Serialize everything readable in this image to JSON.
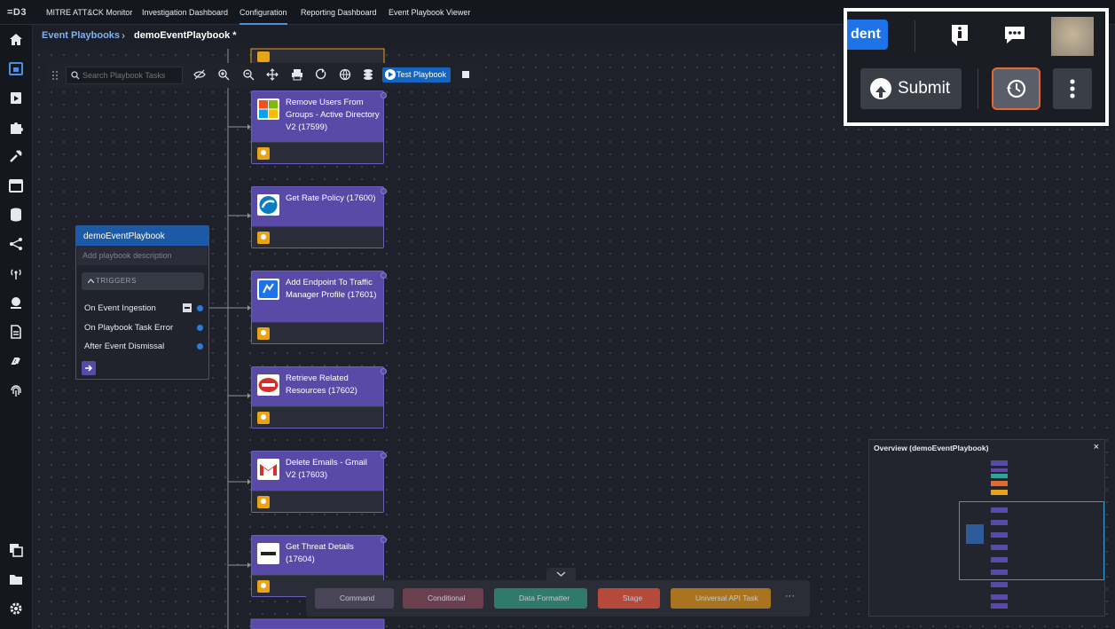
{
  "app": {
    "logo_text": "=D3"
  },
  "topnav": {
    "tabs": [
      {
        "label": "MITRE ATT&CK Monitor"
      },
      {
        "label": "Investigation Dashboard"
      },
      {
        "label": "Configuration"
      },
      {
        "label": "Reporting Dashboard"
      },
      {
        "label": "Event Playbook Viewer"
      }
    ],
    "active_tab": "Configuration"
  },
  "sidebar": {
    "items": [
      "home-icon",
      "calendar-icon",
      "play-icon",
      "puzzle-icon",
      "tools-icon",
      "schedule-icon",
      "database-icon",
      "share-icon",
      "antenna-icon",
      "globe-icon",
      "document-icon",
      "link-icon",
      "fingerprint-icon",
      "copy-icon",
      "folder-icon",
      "settings-icon"
    ]
  },
  "breadcrumb": {
    "parent": "Event Playbooks",
    "separator": "›",
    "current": "demoEventPlaybook *"
  },
  "toolbar": {
    "search_placeholder": "Search Playbook Tasks",
    "test_button": "Test Playbook"
  },
  "start_node": {
    "title": "demoEventPlaybook",
    "description_placeholder": "Add playbook description",
    "triggers_label": "TRIGGERS",
    "triggers": [
      {
        "label": "On Event Ingestion"
      },
      {
        "label": "On Playbook Task Error"
      },
      {
        "label": "After Event Dismissal"
      }
    ]
  },
  "tasks": [
    {
      "name": "Remove Users From Groups - Active Directory V2 (17599)",
      "icon": "microsoft-icon"
    },
    {
      "name": "Get Rate Policy (17600)",
      "icon": "cloud-icon"
    },
    {
      "name": "Add Endpoint To Traffic Manager Profile (17601)",
      "icon": "azure-icon"
    },
    {
      "name": "Retrieve Related Resources (17602)",
      "icon": "resource-icon"
    },
    {
      "name": "Delete Emails - Gmail V2 (17603)",
      "icon": "gmail-icon"
    },
    {
      "name": "Get Threat Details (17604)",
      "icon": "proofpoint-icon"
    }
  ],
  "overview": {
    "title": "Overview (demoEventPlaybook)",
    "close": "×"
  },
  "palette": {
    "items": [
      {
        "label": "Command",
        "color": "#4a4458"
      },
      {
        "label": "Conditional",
        "color": "#6a3f4e"
      },
      {
        "label": "Data Formatter",
        "color": "#2f7a6a"
      },
      {
        "label": "Stage",
        "color": "#b5493a"
      },
      {
        "label": "Universal API Task",
        "color": "#a8741f"
      }
    ],
    "more": "···"
  },
  "zoom": {
    "partial_label": "dent",
    "submit_label": "Submit"
  }
}
